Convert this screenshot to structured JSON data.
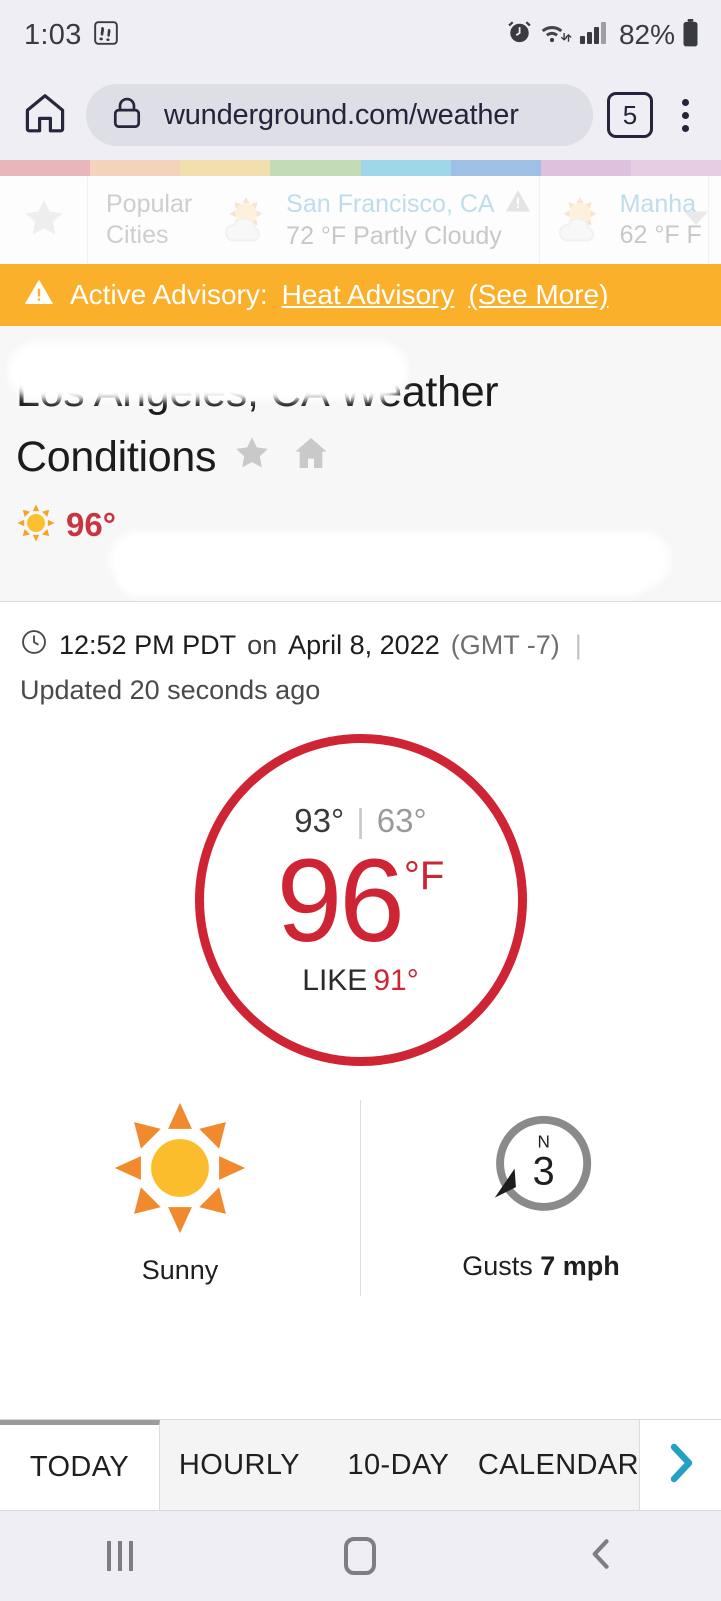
{
  "status_bar": {
    "time": "1:03",
    "pedometer_icon": "footsteps-icon",
    "alarm_icon": "alarm-icon",
    "wifi_icon": "wifi-icon",
    "signal_icon": "cellular-signal-icon",
    "battery_percent": "82%",
    "battery_icon": "battery-icon"
  },
  "browser": {
    "home_icon": "home-icon",
    "lock_icon": "lock-icon",
    "url": "wunderground.com/weather",
    "tab_count": "5",
    "menu_icon": "kebab-menu-icon"
  },
  "carousel": {
    "star_icon": "star-icon",
    "popular_label_line1": "Popular",
    "popular_label_line2": "Cities",
    "caret_icon": "chevron-down-icon",
    "cities": [
      {
        "name": "San Francisco, CA",
        "conditions": "72 °F Partly Cloudy",
        "icon": "partly-cloudy-icon",
        "alert_icon": "alert-triangle-icon"
      },
      {
        "name": "Manha",
        "conditions": "62 °F F",
        "icon": "partly-cloudy-icon",
        "alert_icon": ""
      }
    ],
    "stripe_colors": [
      "#e8b6bb",
      "#f3d4bb",
      "#f1dfae",
      "#c3dcb6",
      "#9ed6ea",
      "#9dc0e4",
      "#dec2dd",
      "#e6cde3"
    ]
  },
  "advisory": {
    "warning_icon": "warning-triangle-icon",
    "prefix": "Active Advisory:",
    "link": "Heat Advisory",
    "more": "(See More)",
    "background": "#fbb02b"
  },
  "header": {
    "title": "Los Angeles, CA Weather Conditions",
    "favorite_icon": "star-icon",
    "home_icon": "house-icon",
    "sun_icon": "sun-icon",
    "temp": "96°"
  },
  "observation": {
    "clock_icon": "clock-icon",
    "time": "12:52 PM PDT",
    "on": "on",
    "date": "April 8, 2022",
    "gmt": "(GMT -7)",
    "separator": "|",
    "updated": "Updated 20 seconds ago"
  },
  "current": {
    "high": "93°",
    "divider": "|",
    "low": "63°",
    "temperature": "96",
    "unit": "°F",
    "feels_like_label": "LIKE",
    "feels_like": "91°",
    "circle_color": "#cf2433"
  },
  "conditions": {
    "sky": {
      "icon": "sun-icon",
      "label": "Sunny"
    },
    "wind": {
      "icon": "wind-compass-icon",
      "compass_direction": "N",
      "speed": "3",
      "gusts_prefix": "Gusts",
      "gusts_value": "7 mph"
    }
  },
  "tabs": {
    "items": [
      "TODAY",
      "HOURLY",
      "10-DAY",
      "CALENDAR"
    ],
    "active_index": 0,
    "next_icon": "chevron-right-icon",
    "next_color": "#23a0c4"
  },
  "nav_bar": {
    "recents_icon": "recents-icon",
    "home_icon": "home-square-icon",
    "back_icon": "back-chevron-icon"
  }
}
